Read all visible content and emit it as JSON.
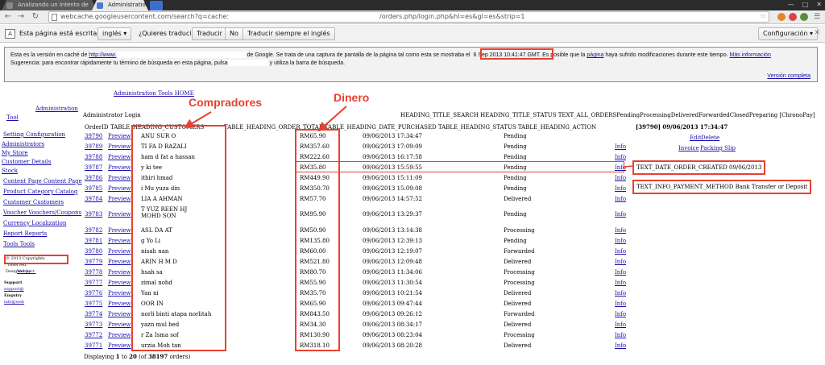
{
  "browser": {
    "tabs": [
      {
        "label": "Analizando un intento de"
      },
      {
        "label": "Administration"
      }
    ],
    "url_part1": "webcache.googleusercontent.com/search?q=cache:",
    "url_part2": "/orders.php/login.php&hl=es&gl=es&strip=1"
  },
  "translate_bar": {
    "prefix": "Esta página está escrita en",
    "language": "inglés",
    "question": "¿Quieres traducirla?",
    "translate": "Traducir",
    "no": "No",
    "always": "Traducir siempre el inglés",
    "settings": "Configuración"
  },
  "cache_notice": {
    "l1_a": "Esta es la versión en caché de",
    "l1_link": "http://www.",
    "l1_b": "de Google. Se trata de una captura de pantalla de la página tal como esta se mostraba el",
    "date": "6 Sep 2013 10:41:47 GMT",
    "l1_c": ". Es posible que la",
    "pagina": "página",
    "l1_d": "haya sufrido modificaciones durante este tiempo.",
    "more_info": "Más información",
    "l2_a": "Sugerencia: para encontrar rápidamente tu término de búsqueda en esta página, pulsa",
    "l2_b": "y utiliza la barra de búsqueda.",
    "full_version": "Versión completa"
  },
  "page": {
    "breadcrumb": "Administration Tools  HOME",
    "top_left": "Administrator Login",
    "top_headers": "HEADING_TITLE_SEARCH HEADING_TITLE_STATUS TEXT_ALL_ORDERSPendingProcessingDeliveredForwardedClosedPreparing [ChronoPay]",
    "col_orderid": "OrderID",
    "col_customers": "TABLE_HEADING_CUSTOMERS",
    "col_rest": "TABLE_HEADING_ORDER_TOTAL TABLE_HEADING_DATE_PURCHASED TABLE_HEADING_STATUS TABLE_HEADING_ACTION",
    "selected_header": "[39790]  09/06/2013 17:34:47",
    "edit": "Edit",
    "delete": "Delete",
    "invoice": "Invoice",
    "packing_slip": "Packing Slip",
    "date_created": "TEXT_DATE_ORDER_CREATED 09/06/2013",
    "payment_method": "TEXT_INFO_PAYMENT_METHOD Bank Transfer or Deposit",
    "footer_a": "Displaying ",
    "footer_from": "1",
    "footer_b": " to ",
    "footer_to": "20",
    "footer_c": " (of ",
    "footer_total": "38197",
    "footer_d": " orders)"
  },
  "sidebar": {
    "admin_a": "Administration",
    "admin_b": "Tool",
    "items": [
      "Setting  Configuration",
      "Administrators",
      "My Store",
      "Customer Details",
      "Stock",
      "Content Page  Content Page",
      "Product Category  Catalog",
      "Customer  Customers",
      "Voucher  Vouchers/Coupons",
      "Currency  Localization",
      "Report  Reports",
      "Tools  Tools"
    ],
    "copyright": "© 2013 Copyrights",
    "reserved": "reserved.",
    "designed_by": "Designed by",
    "webpact": "Webpact.",
    "support": "Support",
    "support_email": "support@",
    "enquiry": "Enquiry",
    "info_email": "info@web"
  },
  "annotations": {
    "compradores": "Compradores",
    "dinero": "Dinero"
  },
  "orders": [
    {
      "id": "39790",
      "preview": "Preview",
      "customer": "ANU   SUR      O",
      "total": "RM65.90",
      "date": "09/06/2013 17:34:47",
      "status": "Pending",
      "info": ""
    },
    {
      "id": "39789",
      "preview": "Preview",
      "customer": "TI FA        D RAZALI",
      "total": "RM357.60",
      "date": "09/06/2013 17:09:09",
      "status": "Pending",
      "info": "Info"
    },
    {
      "id": "39788",
      "preview": "Preview",
      "customer": "ham   d fat     a hassan",
      "total": "RM222.60",
      "date": "09/06/2013 16:17:58",
      "status": "Pending",
      "info": "Info"
    },
    {
      "id": "39787",
      "preview": "Preview",
      "customer": "y ki       tee",
      "total": "RM35.80",
      "date": "09/06/2013 15:59:55",
      "status": "Pending",
      "info": "Info"
    },
    {
      "id": "39786",
      "preview": "Preview",
      "customer": "ithiri      hmad",
      "total": "RM449.90",
      "date": "09/06/2013 15:11:09",
      "status": "Pending",
      "info": "Info"
    },
    {
      "id": "39785",
      "preview": "Preview",
      "customer": "i Mu    yuza     din",
      "total": "RM350.70",
      "date": "09/06/2013 15:09:08",
      "status": "Pending",
      "info": "Info"
    },
    {
      "id": "39784",
      "preview": "Preview",
      "customer": "LIA    A   AHMAN",
      "total": "RM57.70",
      "date": "09/06/2013 14:57:52",
      "status": "Delivered",
      "info": "Info"
    },
    {
      "id": "39783",
      "preview": "Preview",
      "customer": "T YUZ    REEN HJ  MOHD   SON",
      "total": "RM95.90",
      "date": "09/06/2013 13:29:37",
      "status": "Pending",
      "info": "Info",
      "tall": true
    },
    {
      "id": "39782",
      "preview": "Preview",
      "customer": "ASL    DA   AT",
      "total": "RM50.90",
      "date": "09/06/2013 13:14:38",
      "status": "Processing",
      "info": "Info"
    },
    {
      "id": "39781",
      "preview": "Preview",
      "customer": "g Yo   Li",
      "total": "RM135.80",
      "date": "09/06/2013 12:39:13",
      "status": "Pending",
      "info": "Info"
    },
    {
      "id": "39780",
      "preview": "Preview",
      "customer": "nisah    nan",
      "total": "RM60.00",
      "date": "09/06/2013 12:19:07",
      "status": "Forwarded",
      "info": "Info"
    },
    {
      "id": "39779",
      "preview": "Preview",
      "customer": "ARIN   H M    D",
      "total": "RM521.80",
      "date": "09/06/2013 12:09:48",
      "status": "Delivered",
      "info": "Info"
    },
    {
      "id": "39778",
      "preview": "Preview",
      "customer": "hsah     sa",
      "total": "RM80.70",
      "date": "09/06/2013 11:34:06",
      "status": "Processing",
      "info": "Info"
    },
    {
      "id": "39777",
      "preview": "Preview",
      "customer": "zimal    nohd",
      "total": "RM55.90",
      "date": "09/06/2013 11:30:54",
      "status": "Processing",
      "info": "Info"
    },
    {
      "id": "39776",
      "preview": "Preview",
      "customer": "Yan     ni",
      "total": "RM35.70",
      "date": "09/06/2013 10:21:54",
      "status": "Delivered",
      "info": "Info"
    },
    {
      "id": "39775",
      "preview": "Preview",
      "customer": "OOR     IN",
      "total": "RM65.90",
      "date": "09/06/2013 09:47:44",
      "status": "Delivered",
      "info": "Info"
    },
    {
      "id": "39774",
      "preview": "Preview",
      "customer": "norli    binti   atapa norlitah",
      "total": "RM843.50",
      "date": "09/06/2013 09:26:12",
      "status": "Forwarded",
      "info": "Info"
    },
    {
      "id": "39773",
      "preview": "Preview",
      "customer": "yazn    mul    hed",
      "total": "RM34.30",
      "date": "09/06/2013 08:34:17",
      "status": "Delivered",
      "info": "Info"
    },
    {
      "id": "39772",
      "preview": "Preview",
      "customer": "r Za   Isma     sof",
      "total": "RM130.90",
      "date": "09/06/2013 08:23:04",
      "status": "Processing",
      "info": "Info"
    },
    {
      "id": "39771",
      "preview": "Preview",
      "customer": "urzia    Moh    tan",
      "total": "RM318.10",
      "date": "09/06/2013 08:20:28",
      "status": "Delivered",
      "info": "Info"
    }
  ],
  "colors": {
    "annotation_red": "#e8412f",
    "link_blue": "#1a0dab",
    "chrome_dark": "#2b2b2b"
  }
}
